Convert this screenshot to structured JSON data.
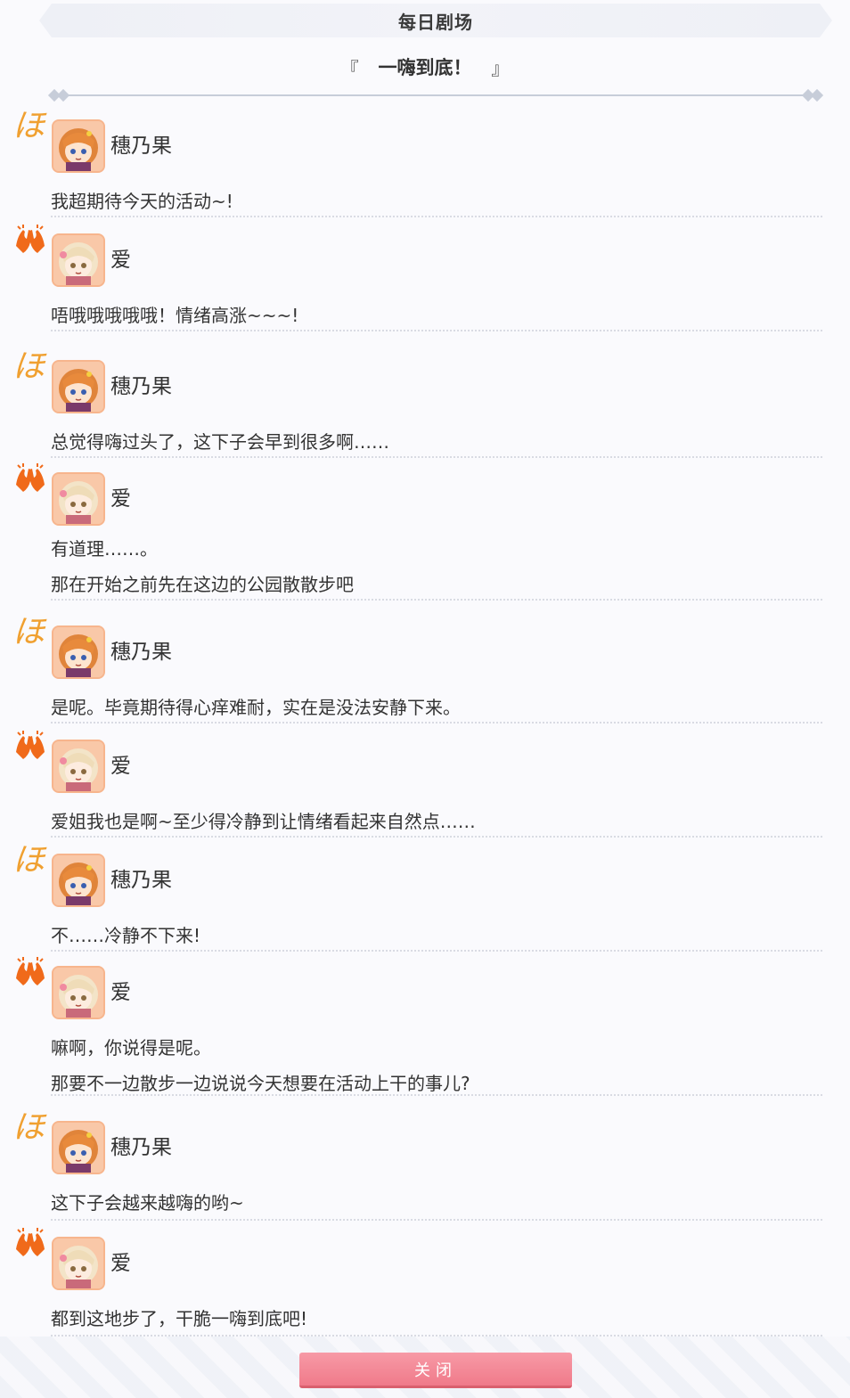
{
  "header": {
    "title": "每日剧场"
  },
  "story": {
    "open_bracket": "『",
    "title": "一嗨到底！",
    "close_bracket": "』"
  },
  "speakers": {
    "honoka": {
      "name": "穗乃果",
      "mark": "ほ",
      "mark_icon": "hiragana-ho-icon",
      "avatar_icon": "honoka-avatar-icon"
    },
    "ai": {
      "name": "爱",
      "mark_icon": "raised-hands-icon",
      "avatar_icon": "ai-avatar-icon"
    }
  },
  "dialogue": [
    {
      "speaker": "穗乃果",
      "lines": [
        "我超期待今天的活动~!"
      ]
    },
    {
      "speaker": "爱",
      "lines": [
        "唔哦哦哦哦哦！情绪高涨~~~!"
      ]
    },
    {
      "speaker": "穗乃果",
      "lines": [
        "总觉得嗨过头了，这下子会早到很多啊……"
      ]
    },
    {
      "speaker": "爱",
      "lines": [
        "有道理……。",
        "那在开始之前先在这边的公园散散步吧"
      ]
    },
    {
      "speaker": "穗乃果",
      "lines": [
        "是呢。毕竟期待得心痒难耐，实在是没法安静下来。"
      ]
    },
    {
      "speaker": "爱",
      "lines": [
        "爱姐我也是啊~至少得冷静到让情绪看起来自然点……"
      ]
    },
    {
      "speaker": "穗乃果",
      "lines": [
        "不……冷静不下来!"
      ]
    },
    {
      "speaker": "爱",
      "lines": [
        "嘛啊，你说得是呢。",
        "那要不一边散步一边说说今天想要在活动上干的事儿?"
      ]
    },
    {
      "speaker": "穗乃果",
      "lines": [
        "这下子会越来越嗨的哟~"
      ]
    },
    {
      "speaker": "爱",
      "lines": [
        "都到这地步了，干脆一嗨到底吧!"
      ]
    }
  ],
  "footer": {
    "close_label": "关闭"
  },
  "colors": {
    "accent_button": "#f07a8a",
    "honoka_mark": "#f0a030",
    "ai_mark": "#f06a1a"
  }
}
